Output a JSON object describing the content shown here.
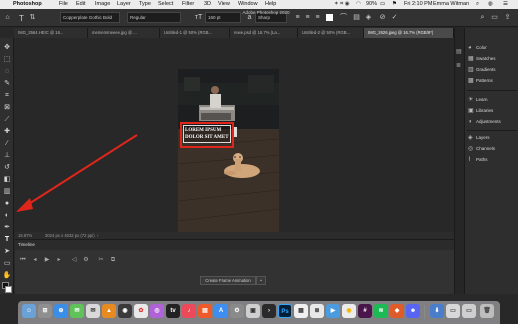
{
  "menubar": {
    "items": [
      "Photoshop",
      "File",
      "Edit",
      "Image",
      "Layer",
      "Type",
      "Select",
      "Filter",
      "3D",
      "View",
      "Window",
      "Help"
    ],
    "app_title": "Adobe Photoshop 2020",
    "battery": "90%",
    "time": "Fri 2:10 PM",
    "user": "Emma Witman"
  },
  "options": {
    "font_family": "Copperplate Gothic Bold",
    "font_style": "Regular",
    "font_size": "160 pt",
    "antialias": "Sharp"
  },
  "tabs": [
    {
      "label": "IMG_3564.HEIC @ 16...",
      "active": false
    },
    {
      "label": "mememmeeee.jpg @ ...",
      "active": false
    },
    {
      "label": "Untitled-1 @ 50% (RGB...",
      "active": false
    },
    {
      "label": "rewe.psd @ 16.7% (La...",
      "active": false
    },
    {
      "label": "Untitled-2 @ 50% (RGB...",
      "active": false
    },
    {
      "label": "IMG_2626.jpeg @ 16.7% (RGB/8*)",
      "active": true
    }
  ],
  "canvas": {
    "text_line1": "LOREM IPSUM",
    "text_line2": "DOLOR SIT AMET",
    "annotation_color": "#e0261a"
  },
  "status": {
    "zoom": "16.67%",
    "doc_info": "3024 px x 4032 px (72 ppi)"
  },
  "timeline": {
    "title": "Timeline",
    "create_button": "Create Frame Animation"
  },
  "panels": {
    "group1": [
      "Color",
      "Swatches",
      "Gradients",
      "Patterns"
    ],
    "group2": [
      "Learn",
      "Libraries",
      "Adjustments"
    ],
    "group3": [
      "Layers",
      "Channels",
      "Paths"
    ]
  },
  "dock": {
    "ps_label": "Ps",
    "tv_label": "tv"
  }
}
